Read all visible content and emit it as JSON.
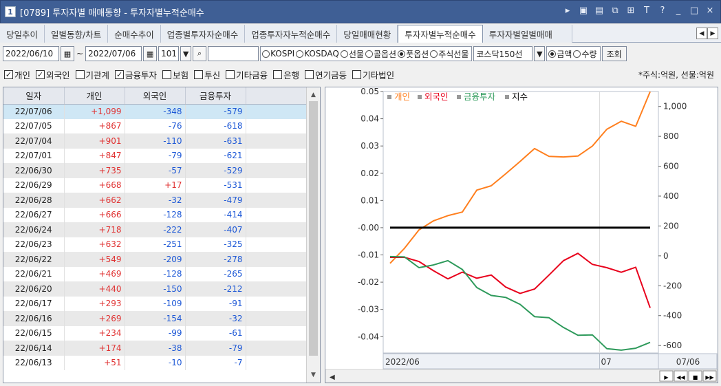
{
  "window": {
    "number": "1",
    "title": "[0789] 투자자별 매매동향 - 투자자별누적순매수"
  },
  "title_icons": [
    "▸",
    "▣",
    "▤",
    "⧉",
    "⊞",
    "T",
    "?",
    "_",
    "□",
    "×"
  ],
  "tabs": [
    {
      "label": "당일추이"
    },
    {
      "label": "일별동향/차트"
    },
    {
      "label": "순매수추이"
    },
    {
      "label": "업종별투자자순매수"
    },
    {
      "label": "업종투자자누적순매수"
    },
    {
      "label": "당일매매현황"
    },
    {
      "label": "투자자별누적순매수",
      "active": true
    },
    {
      "label": "투자자별일별매매"
    }
  ],
  "toolbar": {
    "start_date": "2022/06/10",
    "range_sep": "~",
    "end_date": "2022/07/06",
    "code_value": "101",
    "search_value": "",
    "market_radios": [
      {
        "label": "KOSPI",
        "checked": false
      },
      {
        "label": "KOSDAQ",
        "checked": false
      },
      {
        "label": "선물",
        "checked": false
      },
      {
        "label": "콜옵션",
        "checked": false
      },
      {
        "label": "풋옵션",
        "checked": true
      },
      {
        "label": "주식선물",
        "checked": false
      }
    ],
    "select_value": "코스닥150선",
    "unit_radios": [
      {
        "label": "금액",
        "checked": true
      },
      {
        "label": "수량",
        "checked": false
      }
    ],
    "query_label": "조회"
  },
  "investor_checks": [
    {
      "label": "개인",
      "checked": true
    },
    {
      "label": "외국인",
      "checked": true
    },
    {
      "label": "기관계",
      "checked": false
    },
    {
      "label": "금융투자",
      "checked": true
    },
    {
      "label": "보험",
      "checked": false
    },
    {
      "label": "투신",
      "checked": false
    },
    {
      "label": "기타금융",
      "checked": false
    },
    {
      "label": "은행",
      "checked": false
    },
    {
      "label": "연기금등",
      "checked": false
    },
    {
      "label": "기타법인",
      "checked": false
    }
  ],
  "unit_note": "*주식:억원, 선물:억원",
  "table": {
    "headers": [
      "일자",
      "개인",
      "외국인",
      "금융투자"
    ],
    "rows": [
      {
        "date": "22/07/06",
        "individual": "+1,099",
        "foreign": "-348",
        "finance": "-579"
      },
      {
        "date": "22/07/05",
        "individual": "+867",
        "foreign": "-76",
        "finance": "-618"
      },
      {
        "date": "22/07/04",
        "individual": "+901",
        "foreign": "-110",
        "finance": "-631"
      },
      {
        "date": "22/07/01",
        "individual": "+847",
        "foreign": "-79",
        "finance": "-621"
      },
      {
        "date": "22/06/30",
        "individual": "+735",
        "foreign": "-57",
        "finance": "-529"
      },
      {
        "date": "22/06/29",
        "individual": "+668",
        "foreign": "+17",
        "finance": "-531"
      },
      {
        "date": "22/06/28",
        "individual": "+662",
        "foreign": "-32",
        "finance": "-479"
      },
      {
        "date": "22/06/27",
        "individual": "+666",
        "foreign": "-128",
        "finance": "-414"
      },
      {
        "date": "22/06/24",
        "individual": "+718",
        "foreign": "-222",
        "finance": "-407"
      },
      {
        "date": "22/06/23",
        "individual": "+632",
        "foreign": "-251",
        "finance": "-325"
      },
      {
        "date": "22/06/22",
        "individual": "+549",
        "foreign": "-209",
        "finance": "-278"
      },
      {
        "date": "22/06/21",
        "individual": "+469",
        "foreign": "-128",
        "finance": "-265"
      },
      {
        "date": "22/06/20",
        "individual": "+440",
        "foreign": "-150",
        "finance": "-212"
      },
      {
        "date": "22/06/17",
        "individual": "+293",
        "foreign": "-109",
        "finance": "-91"
      },
      {
        "date": "22/06/16",
        "individual": "+269",
        "foreign": "-154",
        "finance": "-32"
      },
      {
        "date": "22/06/15",
        "individual": "+234",
        "foreign": "-99",
        "finance": "-61"
      },
      {
        "date": "22/06/14",
        "individual": "+174",
        "foreign": "-38",
        "finance": "-79"
      },
      {
        "date": "22/06/13",
        "individual": "+51",
        "foreign": "-10",
        "finance": "-7"
      }
    ]
  },
  "colors": {
    "individual": "#ff7f1e",
    "foreign": "#e8001c",
    "finance": "#2e9a5b",
    "index": "#000000",
    "positive": "#e03131",
    "negative": "#1c57d6",
    "title_bar": "#3f5f95"
  },
  "chart_data": {
    "type": "line",
    "legend": [
      "개인",
      "외국인",
      "금융투자",
      "지수"
    ],
    "legend_position": "top-left",
    "x": [
      "22/06/10",
      "22/06/13",
      "22/06/14",
      "22/06/15",
      "22/06/16",
      "22/06/17",
      "22/06/20",
      "22/06/21",
      "22/06/22",
      "22/06/23",
      "22/06/24",
      "22/06/27",
      "22/06/28",
      "22/06/29",
      "22/06/30",
      "22/07/01",
      "22/07/04",
      "22/07/05",
      "22/07/06"
    ],
    "x_tick_labels": [
      "2022/06",
      "07",
      "07/06"
    ],
    "left_axis": {
      "ticks": [
        "0.05",
        "0.04",
        "0.03",
        "0.02",
        "0.01",
        "-0.00",
        "-0.01",
        "-0.02",
        "-0.03",
        "-0.04"
      ],
      "range": [
        -0.046,
        0.05
      ]
    },
    "right_axis": {
      "ticks": [
        "1,000",
        "800",
        "600",
        "400",
        "200",
        "0",
        "-200",
        "-400",
        "-600"
      ],
      "range": [
        -650,
        1100
      ]
    },
    "series": [
      {
        "name": "개인",
        "axis": "right",
        "values": [
          -50,
          51,
          174,
          234,
          269,
          293,
          440,
          469,
          549,
          632,
          718,
          666,
          662,
          668,
          735,
          847,
          901,
          867,
          1099
        ]
      },
      {
        "name": "외국인",
        "axis": "right",
        "values": [
          -10,
          -10,
          -38,
          -99,
          -154,
          -109,
          -150,
          -128,
          -209,
          -251,
          -222,
          -128,
          -32,
          17,
          -57,
          -79,
          -110,
          -76,
          -348
        ]
      },
      {
        "name": "금융투자",
        "axis": "right",
        "values": [
          -5,
          -7,
          -79,
          -61,
          -32,
          -91,
          -212,
          -265,
          -278,
          -325,
          -407,
          -414,
          -479,
          -531,
          -529,
          -621,
          -631,
          -618,
          -579
        ]
      },
      {
        "name": "지수",
        "axis": "left",
        "values": [
          0.0,
          0.0,
          0.0,
          0.0,
          0.0,
          0.0,
          0.0,
          0.0,
          0.0,
          0.0,
          0.0,
          0.0,
          0.0,
          0.0,
          0.0,
          0.0,
          0.0,
          0.0,
          0.0
        ]
      }
    ],
    "grid": true
  }
}
